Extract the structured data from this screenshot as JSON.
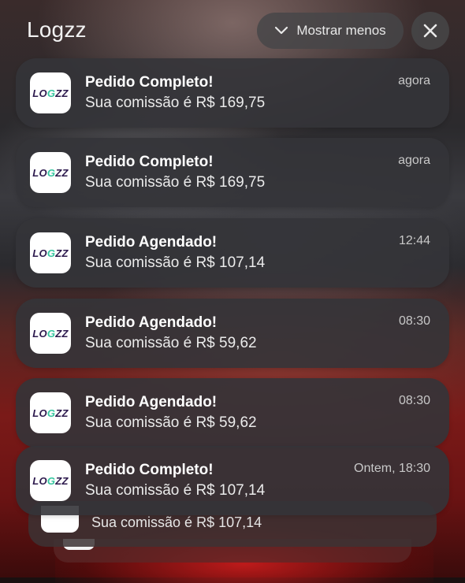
{
  "header": {
    "app_name": "Logzz",
    "show_less_label": "Mostrar menos"
  },
  "logo": {
    "prefix": "LO",
    "g": "G",
    "suffix": "ZZ"
  },
  "notifications": [
    {
      "title": "Pedido Completo!",
      "body": "Sua comissão é R$ 169,75",
      "time": "agora"
    },
    {
      "title": "Pedido Completo!",
      "body": "Sua comissão é R$ 169,75",
      "time": "agora"
    },
    {
      "title": "Pedido Agendado!",
      "body": "Sua comissão é R$ 107,14",
      "time": "12:44"
    },
    {
      "title": "Pedido Agendado!",
      "body": "Sua comissão é R$ 59,62",
      "time": "08:30"
    },
    {
      "title": "Pedido Agendado!",
      "body": "Sua comissão é R$ 59,62",
      "time": "08:30"
    },
    {
      "title": "Pedido Completo!",
      "body": "Sua comissão é R$ 107,14",
      "time": "Ontem, 18:30"
    }
  ],
  "stacked": [
    {
      "body": "Sua comissão é R$ 107,14"
    }
  ]
}
